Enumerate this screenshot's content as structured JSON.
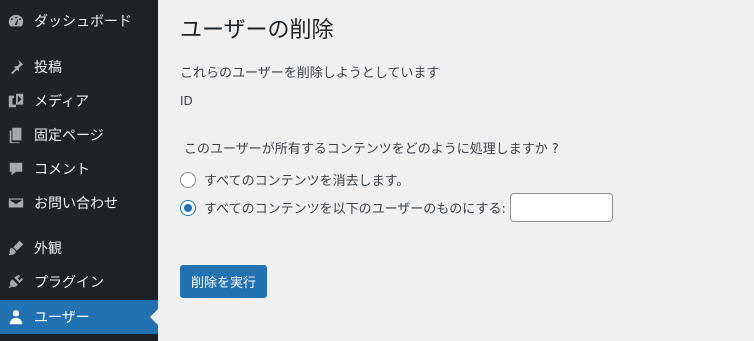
{
  "sidebar": {
    "items": [
      {
        "label": "ダッシュボード",
        "icon": "dashboard-icon"
      },
      {
        "label": "投稿",
        "icon": "pin-icon"
      },
      {
        "label": "メディア",
        "icon": "media-icon"
      },
      {
        "label": "固定ページ",
        "icon": "page-icon"
      },
      {
        "label": "コメント",
        "icon": "comment-icon"
      },
      {
        "label": "お問い合わせ",
        "icon": "mail-icon"
      },
      {
        "label": "外観",
        "icon": "brush-icon"
      },
      {
        "label": "プラグイン",
        "icon": "plugin-icon"
      },
      {
        "label": "ユーザー",
        "icon": "user-icon",
        "active": true
      }
    ]
  },
  "main": {
    "title": "ユーザーの削除",
    "description": "これらのユーザーを削除しようとしています",
    "id_label": "ID",
    "question": "このユーザーが所有するコンテンツをどのように処理しますか ?",
    "options": [
      {
        "label": "すべてのコンテンツを消去します。",
        "checked": false
      },
      {
        "label": "すべてのコンテンツを以下のユーザーのものにする:",
        "checked": true,
        "input_value": ""
      }
    ],
    "submit_label": "削除を実行"
  },
  "colors": {
    "sidebar_bg": "#1d2327",
    "accent": "#2271b1",
    "page_bg": "#f0f0f1"
  }
}
